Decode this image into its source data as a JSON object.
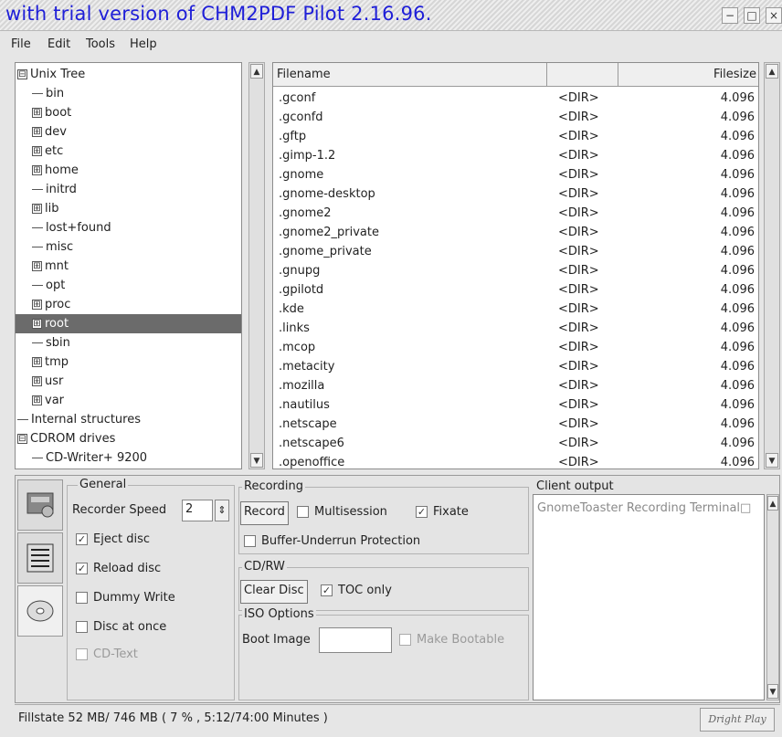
{
  "window": {
    "title": "with trial version of CHM2PDF Pilot 2.16.96.",
    "controls": {
      "minimize": "−",
      "maximize": "□",
      "close": "×"
    }
  },
  "menu": [
    {
      "label": "File"
    },
    {
      "label": "Edit"
    },
    {
      "label": "Tools"
    },
    {
      "label": "Help"
    }
  ],
  "tree": {
    "items": [
      {
        "label": "Unix Tree",
        "expander": "⊟"
      },
      {
        "label": "bin",
        "expander": ""
      },
      {
        "label": "boot",
        "expander": "⊞"
      },
      {
        "label": "dev",
        "expander": "⊞"
      },
      {
        "label": "etc",
        "expander": "⊞"
      },
      {
        "label": "home",
        "expander": "⊞"
      },
      {
        "label": "initrd",
        "expander": ""
      },
      {
        "label": "lib",
        "expander": "⊞"
      },
      {
        "label": "lost+found",
        "expander": ""
      },
      {
        "label": "misc",
        "expander": ""
      },
      {
        "label": "mnt",
        "expander": "⊞"
      },
      {
        "label": "opt",
        "expander": ""
      },
      {
        "label": "proc",
        "expander": "⊞"
      },
      {
        "label": "root",
        "expander": "⊞",
        "selected": true
      },
      {
        "label": "sbin",
        "expander": ""
      },
      {
        "label": "tmp",
        "expander": "⊞"
      },
      {
        "label": "usr",
        "expander": "⊞"
      },
      {
        "label": "var",
        "expander": "⊞"
      },
      {
        "label": "Internal structures",
        "expander": ""
      },
      {
        "label": "CDROM drives",
        "expander": "⊟"
      },
      {
        "label": "CD-Writer+ 9200",
        "expander": ""
      }
    ]
  },
  "file_list": {
    "columns": [
      "Filename",
      "",
      "Filesize"
    ],
    "rows": [
      {
        "name": ".gconf",
        "type": "<DIR>",
        "size": "4.096"
      },
      {
        "name": ".gconfd",
        "type": "<DIR>",
        "size": "4.096"
      },
      {
        "name": ".gftp",
        "type": "<DIR>",
        "size": "4.096"
      },
      {
        "name": ".gimp-1.2",
        "type": "<DIR>",
        "size": "4.096"
      },
      {
        "name": ".gnome",
        "type": "<DIR>",
        "size": "4.096"
      },
      {
        "name": ".gnome-desktop",
        "type": "<DIR>",
        "size": "4.096"
      },
      {
        "name": ".gnome2",
        "type": "<DIR>",
        "size": "4.096"
      },
      {
        "name": ".gnome2_private",
        "type": "<DIR>",
        "size": "4.096"
      },
      {
        "name": ".gnome_private",
        "type": "<DIR>",
        "size": "4.096"
      },
      {
        "name": ".gnupg",
        "type": "<DIR>",
        "size": "4.096"
      },
      {
        "name": ".gpilotd",
        "type": "<DIR>",
        "size": "4.096"
      },
      {
        "name": ".kde",
        "type": "<DIR>",
        "size": "4.096"
      },
      {
        "name": ".links",
        "type": "<DIR>",
        "size": "4.096"
      },
      {
        "name": ".mcop",
        "type": "<DIR>",
        "size": "4.096"
      },
      {
        "name": ".metacity",
        "type": "<DIR>",
        "size": "4.096"
      },
      {
        "name": ".mozilla",
        "type": "<DIR>",
        "size": "4.096"
      },
      {
        "name": ".nautilus",
        "type": "<DIR>",
        "size": "4.096"
      },
      {
        "name": ".netscape",
        "type": "<DIR>",
        "size": "4.096"
      },
      {
        "name": ".netscape6",
        "type": "<DIR>",
        "size": "4.096"
      },
      {
        "name": ".openoffice",
        "type": "<DIR>",
        "size": "4.096"
      }
    ]
  },
  "general": {
    "heading": "General",
    "recorder_speed_label": "Recorder Speed",
    "recorder_speed_value": "2",
    "eject_disc": "Eject disc",
    "reload_disc": "Reload disc",
    "dummy_write": "Dummy Write",
    "disc_at_once": "Disc at once",
    "cd_text": "CD-Text"
  },
  "recording": {
    "heading": "Recording",
    "record_button": "Record",
    "multisession": "Multisession",
    "fixate": "Fixate",
    "buffer_underrun": "Buffer-Underrun Protection"
  },
  "cdrw": {
    "heading": "CD/RW",
    "clear_disc_button": "Clear Disc",
    "toc_only": "TOC only"
  },
  "iso": {
    "heading": "ISO Options",
    "boot_image_label": "Boot Image",
    "boot_image_value": "",
    "make_bootable": "Make Bootable"
  },
  "client_output": {
    "heading": "Client output",
    "text": "GnomeToaster Recording Terminal□"
  },
  "status": {
    "fillstate": "Fillstate 52 MB/ 746 MB (   7 % , 5:12/74:00 Minutes )",
    "brand": "Dright Play"
  },
  "checks": {
    "mark": "✓",
    "eject_disc": true,
    "reload_disc": true,
    "dummy_write": false,
    "disc_at_once": false,
    "cd_text": false,
    "multisession": false,
    "fixate": true,
    "buffer_underrun": false,
    "toc_only": true,
    "make_bootable": false
  },
  "icons": {
    "tab1": "cd-recorder-icon",
    "tab2": "cd-burner-icon",
    "tab3": "cd-disc-icon",
    "scroll_up": "▲",
    "scroll_down": "▼",
    "spin": "⇕"
  }
}
